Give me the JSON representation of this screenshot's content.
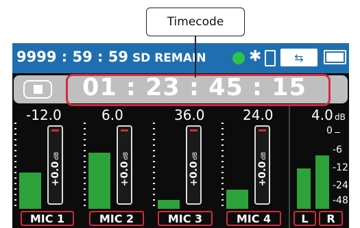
{
  "callout": {
    "label": "Timecode"
  },
  "status": {
    "remain_time": "9999 : 59 : 59",
    "remain_label": "SD REMAIN"
  },
  "timecode": {
    "value": "01 : 23 : 45 : 15"
  },
  "channels": [
    {
      "label": "MIC 1",
      "level": "-12.0",
      "fader": "+0.0",
      "meter_fraction": 0.42
    },
    {
      "label": "MIC 2",
      "level": "6.0",
      "fader": "+0.0",
      "meter_fraction": 0.65
    },
    {
      "label": "MIC 3",
      "level": "36.0",
      "fader": "+0.0",
      "meter_fraction": 0.1
    },
    {
      "label": "MIC 4",
      "level": "24.0",
      "fader": "+0.0",
      "meter_fraction": 0.22
    }
  ],
  "fader_unit": "dB",
  "master": {
    "level": "4.0",
    "unit": "dB",
    "left_label": "L",
    "right_label": "R",
    "scale": [
      "0",
      "-6",
      "-12",
      "-24",
      "-48"
    ],
    "left_fraction": 0.47,
    "right_fraction": 0.62
  },
  "colors": {
    "statusbar": "#1f6fb0",
    "highlight": "#d42a3d",
    "meter": "#2ea23a",
    "record_indicator": "#2bc34a"
  },
  "icons": [
    "stop-icon",
    "record-indicator-icon",
    "bluetooth-icon",
    "smartphone-icon",
    "usb-icon",
    "battery-icon"
  ]
}
